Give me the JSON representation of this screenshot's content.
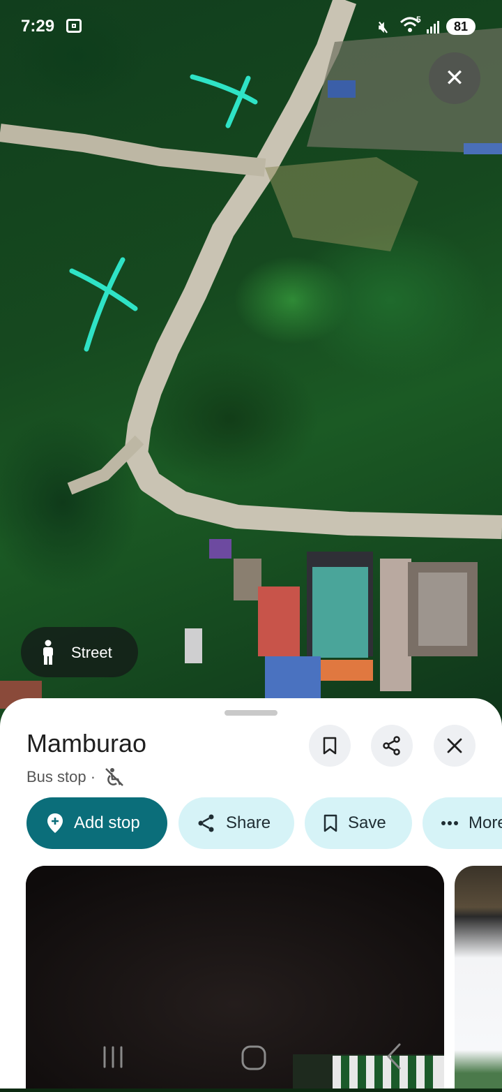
{
  "status_bar": {
    "time": "7:29",
    "battery": "81",
    "wifi_badge": "5"
  },
  "map": {
    "street_view_label": "Street",
    "colors": {
      "road": "#c9c3b3",
      "annotation": "#2fe3c6"
    }
  },
  "place": {
    "title": "Mamburao",
    "subtitle": "Bus stop ·",
    "actions": {
      "add_stop": "Add stop",
      "share": "Share",
      "save": "Save",
      "more": "More"
    },
    "colors": {
      "primary": "#0b6e7a",
      "secondary": "#d6f3f7"
    }
  }
}
